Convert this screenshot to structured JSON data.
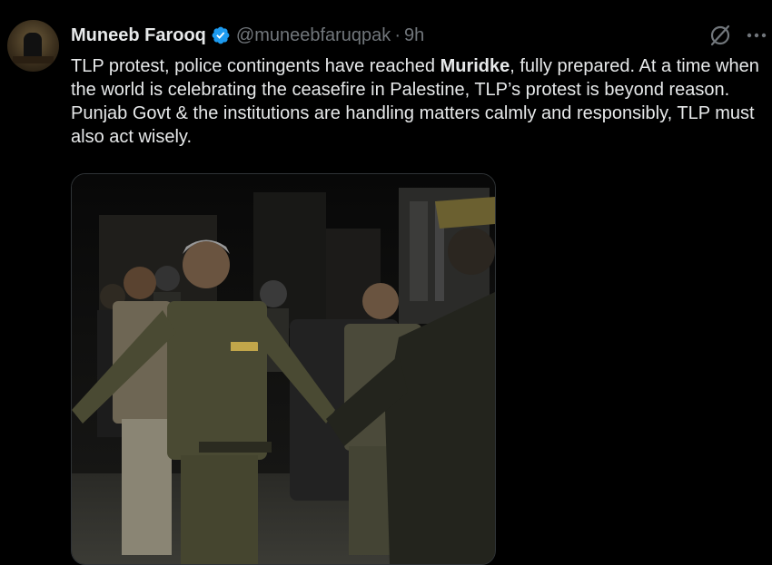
{
  "author": {
    "name": "Muneeb Farooq",
    "handle": "@muneebfaruqpak",
    "separator": "·",
    "time": "9h"
  },
  "tweet": {
    "text_part1": "TLP protest, police contingents have reached ",
    "text_bold": "Muridke",
    "text_part2": ", fully prepared. At a time when the world is celebrating the ceasefire in Palestine, TLP’s protest is beyond reason. Punjab Govt & the institutions are handling matters calmly and responsibly, TLP must also act wisely."
  },
  "icons": {
    "verified": "verified-badge-icon",
    "grok": "grok-icon",
    "more": "more-options-icon"
  },
  "colors": {
    "background": "#000000",
    "text": "#e7e9ea",
    "secondary_text": "#71767b",
    "verified_blue": "#1d9bf0"
  }
}
